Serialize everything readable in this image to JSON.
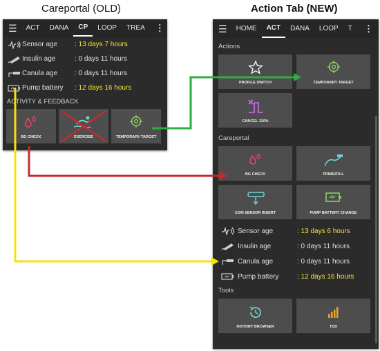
{
  "captions": {
    "old": "Careportal (OLD)",
    "new": "Action Tab (NEW)"
  },
  "old_panel": {
    "tabs": [
      "ACT",
      "DANA",
      "CP",
      "LOOP",
      "TREA"
    ],
    "active_tab": "CP",
    "status": [
      {
        "label": "Sensor age",
        "value": ": 13 days 7 hours",
        "icon": "sensor-icon",
        "warn": true
      },
      {
        "label": "Insulin age",
        "value": ": 0 days 11 hours",
        "icon": "insulin-icon",
        "warn": false
      },
      {
        "label": "Canula age",
        "value": ": 0 days 11 hours",
        "icon": "canula-icon",
        "warn": false
      },
      {
        "label": "Pump battery",
        "value": ": 12 days 16 hours",
        "icon": "battery-icon",
        "warn": true
      }
    ],
    "section": "ACTIVITY & FEEDBACK",
    "buttons": [
      "BG CHECK",
      "EXERCISE",
      "TEMPORARY TARGET"
    ]
  },
  "new_panel": {
    "tabs": [
      "HOME",
      "ACT",
      "DANA",
      "LOOP",
      "T"
    ],
    "active_tab": "ACT",
    "sections": {
      "actions": "Actions",
      "careportal": "Careportal",
      "tools": "Tools"
    },
    "actions_buttons": [
      "PROFILE SWITCH",
      "TEMPORARY TARGET",
      "CANCEL 110%"
    ],
    "careportal_buttons": [
      "BG CHECK",
      "PRIME/FILL",
      "CGM SENSOR INSERT",
      "PUMP BATTERY CHANGE"
    ],
    "status": [
      {
        "label": "Sensor age",
        "value": ": 13 days 6 hours",
        "icon": "sensor-icon",
        "warn": true
      },
      {
        "label": "Insulin age",
        "value": ": 0 days 11 hours",
        "icon": "insulin-icon",
        "warn": false
      },
      {
        "label": "Canula age",
        "value": ": 0 days 11 hours",
        "icon": "canula-icon",
        "warn": false
      },
      {
        "label": "Pump battery",
        "value": ": 12 days 16 hours",
        "icon": "battery-icon",
        "warn": true
      }
    ],
    "tools_buttons": [
      "HISTORY BROWSER",
      "TDD"
    ]
  },
  "colors": {
    "green": "#2fae3c",
    "red": "#c42a2a",
    "yellow": "#f1e40a",
    "pink": "#e8456a",
    "teal": "#6fd4cf",
    "purple": "#cf72f0",
    "lime": "#8bd05a",
    "orange": "#f2a22b",
    "warn_text": "#f2e23c"
  }
}
